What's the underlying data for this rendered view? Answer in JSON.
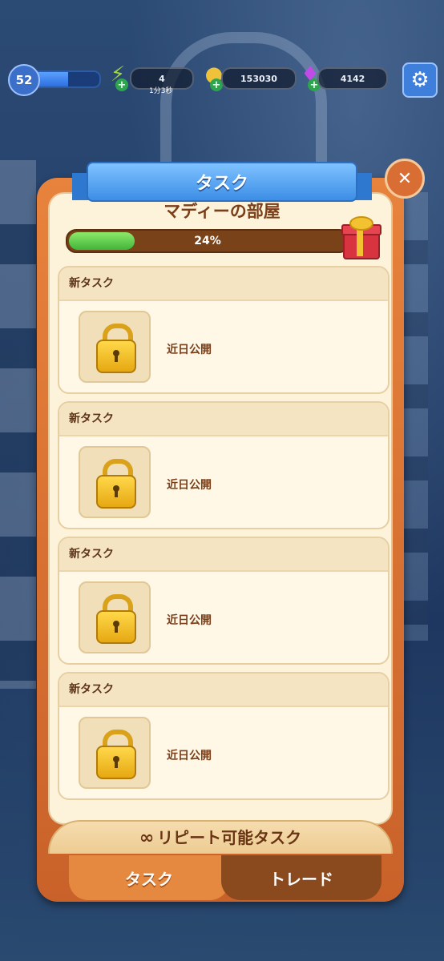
{
  "hud": {
    "level": "52",
    "xp_fraction": 0.55,
    "energy": "4",
    "energy_timer": "1分3秒",
    "coins": "153030",
    "gems": "4142"
  },
  "panel": {
    "title": "タスク",
    "room": "マディーの部屋",
    "progress_percent": 24,
    "progress_label": "24%"
  },
  "tasks": [
    {
      "header": "新タスク",
      "status": "近日公開"
    },
    {
      "header": "新タスク",
      "status": "近日公開"
    },
    {
      "header": "新タスク",
      "status": "近日公開"
    },
    {
      "header": "新タスク",
      "status": "近日公開"
    }
  ],
  "repeatable": {
    "label": "リピート可能タスク",
    "icon": "infinity-icon"
  },
  "tabs": {
    "task": "タスク",
    "trade": "トレード"
  },
  "colors": {
    "accent_blue": "#3c8ee6",
    "panel_orange": "#e7833c",
    "progress_green": "#3fb53a"
  }
}
